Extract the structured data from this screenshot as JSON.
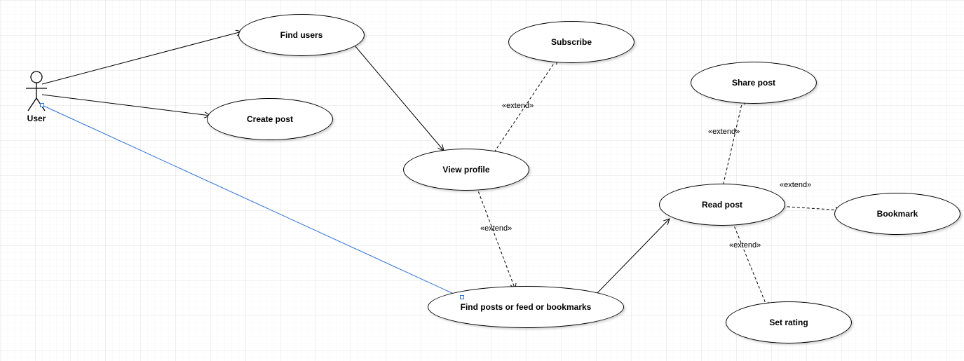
{
  "diagram_type": "uml-use-case",
  "actor": {
    "name": "User"
  },
  "use_cases": {
    "find_users": {
      "label": "Find users"
    },
    "create_post": {
      "label": "Create post"
    },
    "view_profile": {
      "label": "View profile"
    },
    "find_posts": {
      "label": "Find posts or feed or bookmarks"
    },
    "subscribe": {
      "label": "Subscribe"
    },
    "read_post": {
      "label": "Read post"
    },
    "share_post": {
      "label": "Share post"
    },
    "bookmark": {
      "label": "Bookmark"
    },
    "set_rating": {
      "label": "Set rating"
    }
  },
  "associations": [
    {
      "from": "actor",
      "to": "find_users"
    },
    {
      "from": "actor",
      "to": "create_post"
    },
    {
      "from": "actor",
      "to": "find_posts",
      "selected": true
    },
    {
      "from": "find_users",
      "to": "view_profile"
    },
    {
      "from": "find_posts",
      "to": "read_post"
    }
  ],
  "extends": [
    {
      "from": "view_profile",
      "to": "subscribe",
      "label": "«extend»"
    },
    {
      "from": "view_profile",
      "to": "find_posts",
      "label": "«extend»"
    },
    {
      "from": "read_post",
      "to": "share_post",
      "label": "«extend»"
    },
    {
      "from": "read_post",
      "to": "bookmark",
      "label": "«extend»"
    },
    {
      "from": "read_post",
      "to": "set_rating",
      "label": "«extend»"
    }
  ],
  "edge_labels": {
    "vp_subscribe": "«extend»",
    "vp_findposts": "«extend»",
    "rp_sharepost": "«extend»",
    "rp_bookmark": "«extend»",
    "rp_setrating": "«extend»"
  }
}
